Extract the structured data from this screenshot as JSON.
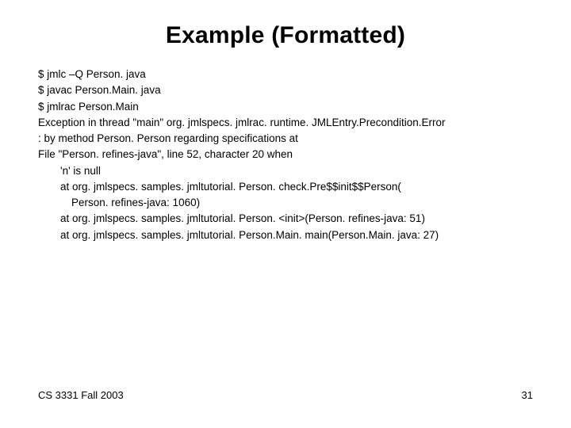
{
  "title": "Example (Formatted)",
  "lines": {
    "l0": "$ jmlc –Q Person. java",
    "l1": "$ javac Person.Main. java",
    "l2": "$ jmlrac Person.Main",
    "l3": "Exception in thread \"main\" org. jmlspecs. jmlrac. runtime. JMLEntry.Precondition.Error",
    "l4": ": by method Person. Person regarding specifications at",
    "l5": "File \"Person. refines-java\", line 52, character 20 when",
    "l6": "'n' is null",
    "l7": "at org. jmlspecs. samples. jmltutorial. Person. check.Pre$$init$$Person(",
    "l8": "Person. refines-java: 1060)",
    "l9": "at org. jmlspecs. samples. jmltutorial. Person. <init>(Person. refines-java: 51)",
    "l10": "at org. jmlspecs. samples. jmltutorial. Person.Main. main(Person.Main. java: 27)"
  },
  "footer": {
    "left": "CS 3331 Fall 2003",
    "right": "31"
  }
}
